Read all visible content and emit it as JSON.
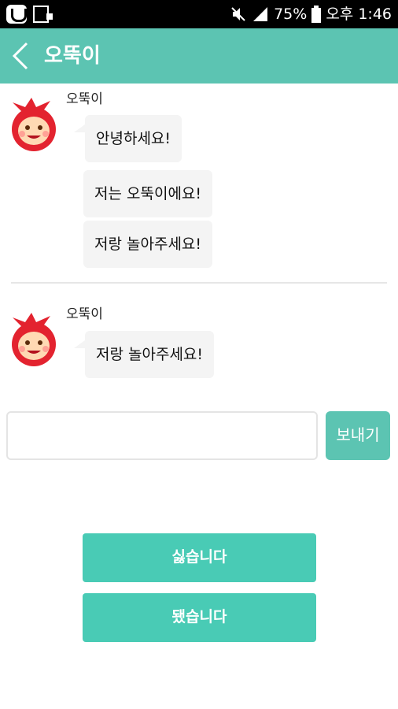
{
  "status_bar": {
    "battery": "75%",
    "time": "오후 1:46",
    "icons": [
      "app-icon",
      "screen-mirror-icon",
      "mute-icon",
      "signal-icon",
      "battery-icon"
    ]
  },
  "app_bar": {
    "title": "오뚝이",
    "back_icon": "chevron-left-icon"
  },
  "chat": {
    "groups": [
      {
        "sender": "오뚝이",
        "messages": [
          "안녕하세요!",
          "저는 오뚝이에요!",
          "저랑 놀아주세요!"
        ]
      },
      {
        "sender": "오뚝이",
        "messages": [
          "저랑 놀아주세요!"
        ]
      }
    ]
  },
  "composer": {
    "value": "",
    "placeholder": "",
    "send_label": "보내기"
  },
  "actions": {
    "decline_label": "싫습니다",
    "accept_label": "됐습니다"
  },
  "colors": {
    "accent": "#5cc4b2",
    "button": "#49cbb5",
    "bubble": "#f4f4f4"
  }
}
